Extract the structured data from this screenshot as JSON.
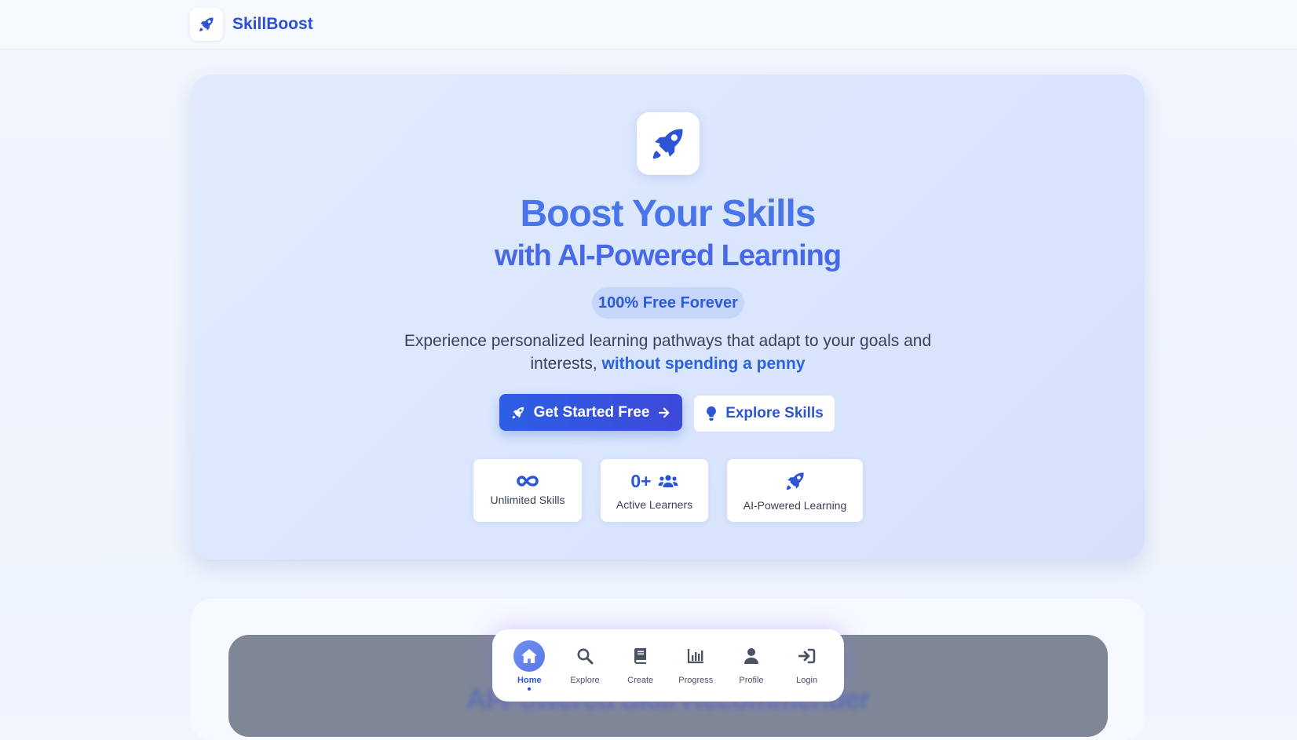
{
  "brand": {
    "name": "SkillBoost",
    "icon": "rocket-icon"
  },
  "hero": {
    "icon": "rocket-icon",
    "title_line1": "Boost Your Skills",
    "title_line2": "with AI-Powered Learning",
    "badge": "100% Free Forever",
    "description": "Experience personalized learning pathways that adapt to your goals and interests,",
    "description_highlight": "without spending a penny",
    "primary_button": {
      "label": "Get Started Free",
      "icon": "rocket-icon",
      "trailing_icon": "arrow-right-icon"
    },
    "secondary_button": {
      "label": "Explore Skills",
      "icon": "lightbulb-icon"
    },
    "stats": [
      {
        "icon": "infinity-icon",
        "value": "",
        "label": "Unlimited Skills"
      },
      {
        "icon": "users-icon",
        "value": "0+",
        "label": "Active Learners"
      },
      {
        "icon": "rocket-icon",
        "value": "",
        "label": "AI-Powered Learning"
      }
    ]
  },
  "section2": {
    "title": "AI-Powered Skill Recommender"
  },
  "bottom_nav": {
    "items": [
      {
        "label": "Home",
        "icon": "home-icon",
        "active": true
      },
      {
        "label": "Explore",
        "icon": "search-icon",
        "active": false
      },
      {
        "label": "Create",
        "icon": "book-icon",
        "active": false
      },
      {
        "label": "Progress",
        "icon": "chart-icon",
        "active": false
      },
      {
        "label": "Profile",
        "icon": "user-icon",
        "active": false
      },
      {
        "label": "Login",
        "icon": "login-icon",
        "active": false
      }
    ]
  },
  "colors": {
    "accent": "#2b55d2",
    "headline": "#4a74ea",
    "badge_bg": "#c6d6fa"
  }
}
